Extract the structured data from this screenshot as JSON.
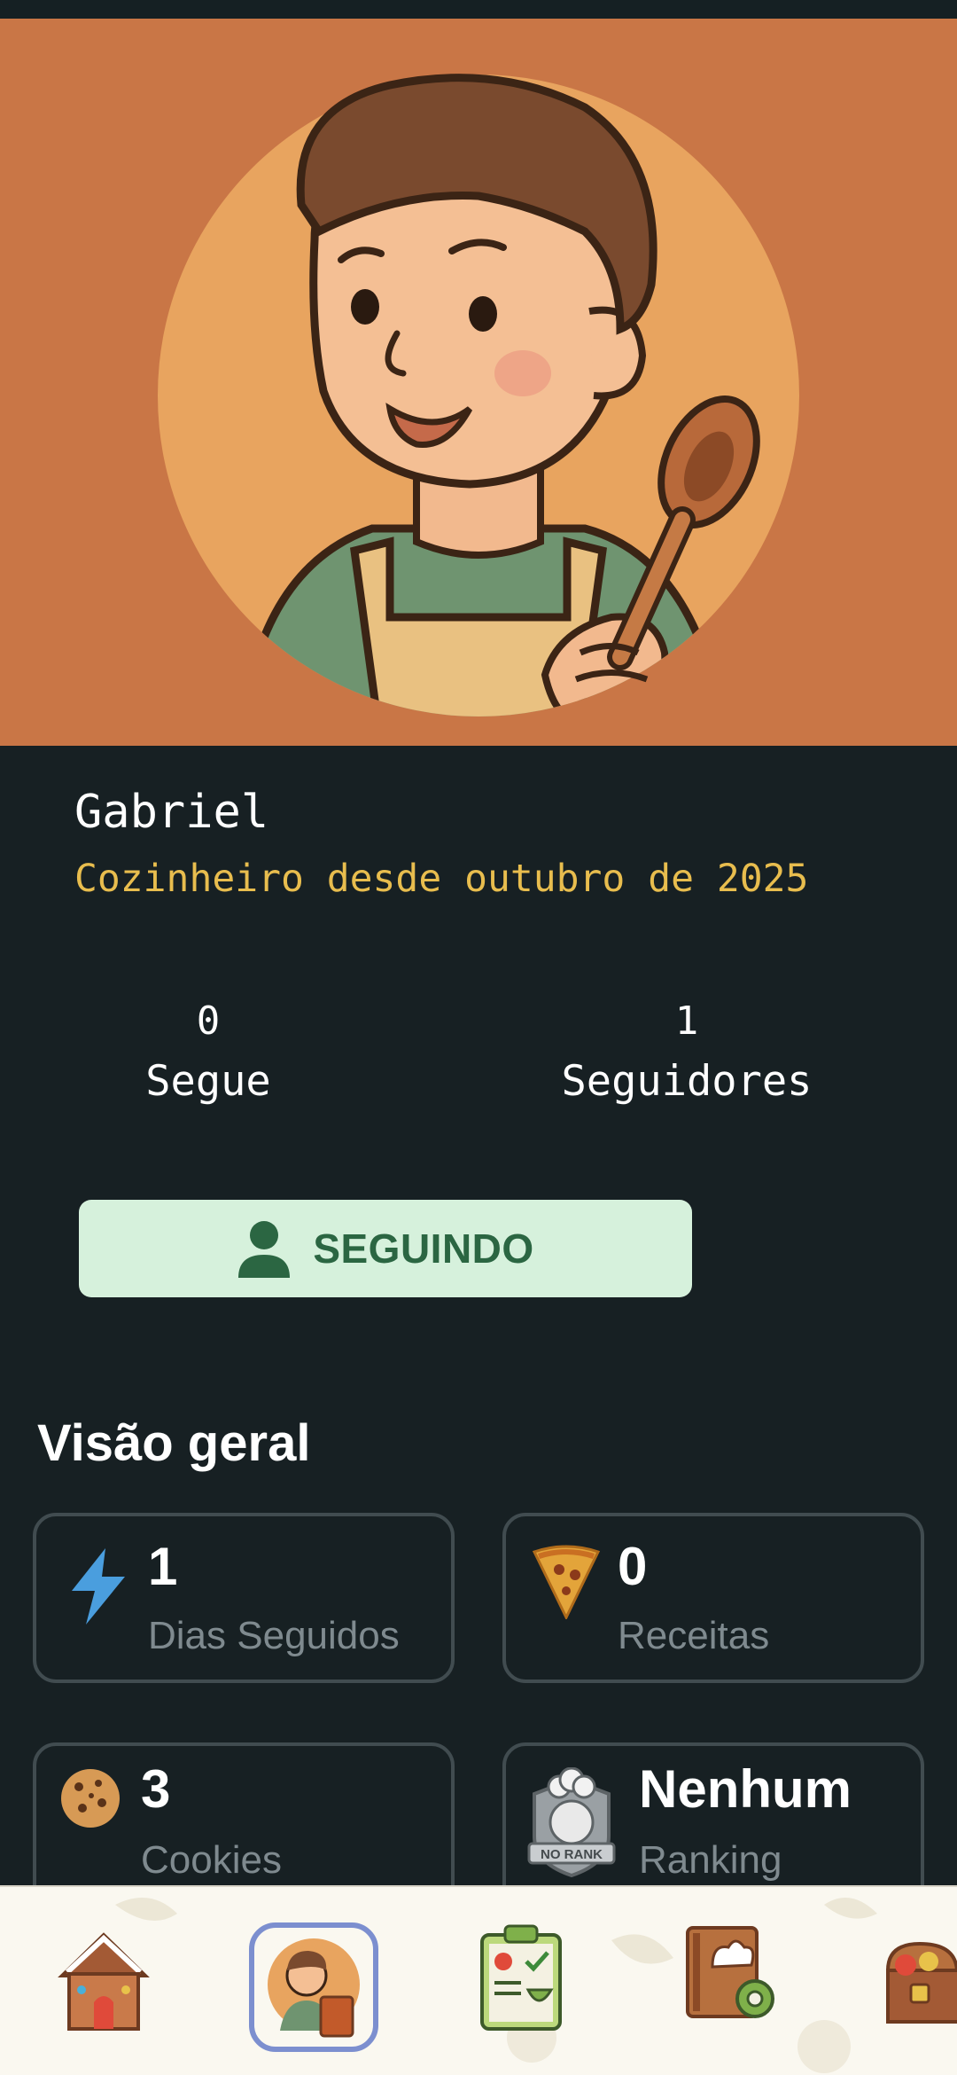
{
  "profile": {
    "name": "Gabriel",
    "since": "Cozinheiro desde outubro de 2025",
    "avatar_icon": "chef-boy-with-spoon-illustration"
  },
  "stats": {
    "follows_count": "0",
    "follows_label": "Segue",
    "followers_count": "1",
    "followers_label": "Seguidores"
  },
  "follow_button": {
    "label": "SEGUINDO",
    "icon": "person-icon"
  },
  "overview": {
    "title": "Visão geral",
    "cards": [
      {
        "value": "1",
        "caption": "Dias Seguidos",
        "icon": "lightning-icon"
      },
      {
        "value": "0",
        "caption": "Receitas",
        "icon": "pizza-slice-icon"
      },
      {
        "value": "3",
        "caption": "Cookies",
        "icon": "cookie-icon"
      },
      {
        "value": "Nenhum",
        "caption": "Ranking",
        "icon": "no-rank-badge-icon",
        "badge_text": "NO RANK"
      }
    ]
  },
  "bottom_nav": {
    "items": [
      {
        "icon": "gingerbread-house-icon"
      },
      {
        "icon": "profile-chef-icon",
        "active": true
      },
      {
        "icon": "meal-plan-clipboard-icon"
      },
      {
        "icon": "recipe-book-settings-icon"
      },
      {
        "icon": "treasure-chest-icon"
      }
    ]
  },
  "colors": {
    "background": "#172023",
    "hero": "#c97646",
    "accent_yellow": "#e8bd4e",
    "follow_button_bg": "#d6f1dc",
    "follow_button_text": "#2b6642",
    "card_border": "#414c50",
    "caption": "#7f8a8f",
    "active_ring": "#7c8fcf"
  }
}
